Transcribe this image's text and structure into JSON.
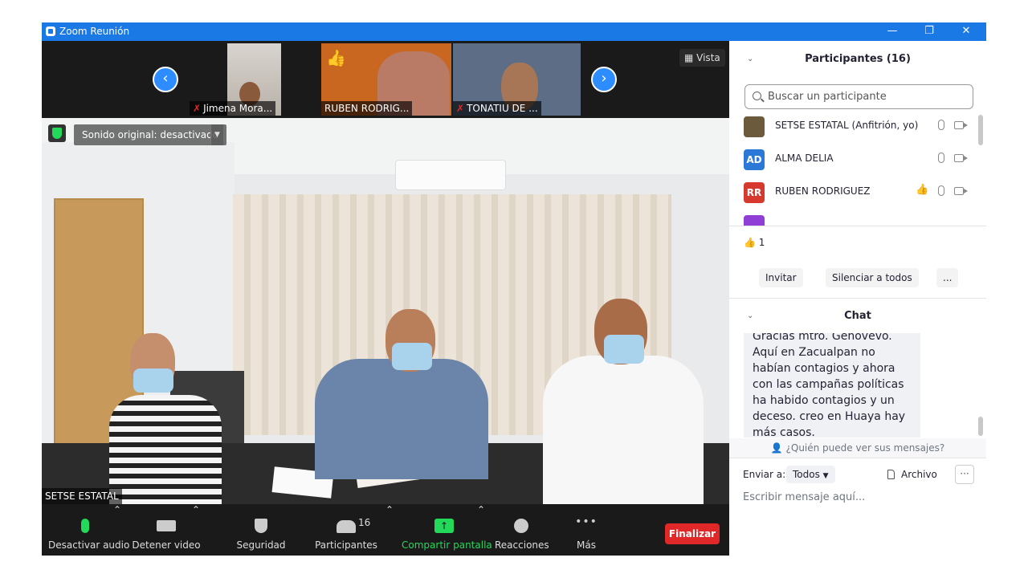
{
  "window": {
    "title": "Zoom Reunión"
  },
  "thumbnails": [
    {
      "name": "Jimena Mora...",
      "muted": true
    },
    {
      "name": "RUBEN RODRIG...",
      "muted": false
    },
    {
      "name": "TONATIU DE ...",
      "muted": true
    }
  ],
  "vista_label": "Vista",
  "video": {
    "sonido": "Sonido original: desactivado",
    "speaker": "SETSE ESTATAL"
  },
  "toolbar": {
    "audio": "Desactivar audio",
    "video": "Detener video",
    "security": "Seguridad",
    "participants": "Participantes",
    "participants_count": "16",
    "share": "Compartir pantalla",
    "reactions": "Reacciones",
    "more": "Más",
    "more_icon": "•••",
    "end": "Finalizar"
  },
  "participants_panel": {
    "title": "Participantes (16)",
    "search_placeholder": "Buscar un participante",
    "list": [
      {
        "initials": "",
        "name": "SETSE ESTATAL (Anfitrión, yo)",
        "color": "#6b5a3c"
      },
      {
        "initials": "AD",
        "name": "ALMA DELIA",
        "color": "#2b78d6"
      },
      {
        "initials": "RR",
        "name": "RUBEN RODRIGUEZ",
        "color": "#d63a2e"
      },
      {
        "initials": "",
        "name": "",
        "color": "#8f3fd6"
      }
    ],
    "reaction_count": "1",
    "invite": "Invitar",
    "mute_all": "Silenciar a todos",
    "more": "..."
  },
  "chat": {
    "title": "Chat",
    "message": "Gracias mtro. Genovevo. Aquí en Zacualpan no habían contagios y ahora con las campañas políticas ha habido contagios y un deceso. creo en Huaya hay más casos.",
    "who_can_see": "¿Quién puede ver sus mensajes?",
    "send_to_label": "Enviar a:",
    "send_to_value": "Todos",
    "file": "Archivo",
    "more": "···",
    "input_placeholder": "Escribir mensaje aquí..."
  }
}
